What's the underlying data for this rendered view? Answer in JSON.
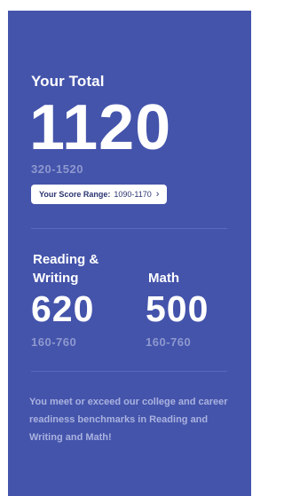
{
  "total": {
    "label": "Your Total",
    "score": "1120",
    "range": "320-1520"
  },
  "score_range_button": {
    "label": "Your Score Range:",
    "value": "1090-1170",
    "chevron": "›",
    "icon": "chevron-right-icon"
  },
  "sections": [
    {
      "label_line1": "Reading &",
      "label_line2": "Writing",
      "score": "620",
      "range": "160-760"
    },
    {
      "label_line1": "",
      "label_line2": "Math",
      "score": "500",
      "range": "160-760"
    }
  ],
  "benchmark_message": "You meet or exceed our college and career readiness benchmarks in Reading and Writing and Math!",
  "colors": {
    "card_background": "#4454ab",
    "muted_text": "#8e98cf",
    "pill_background": "#ffffff"
  }
}
